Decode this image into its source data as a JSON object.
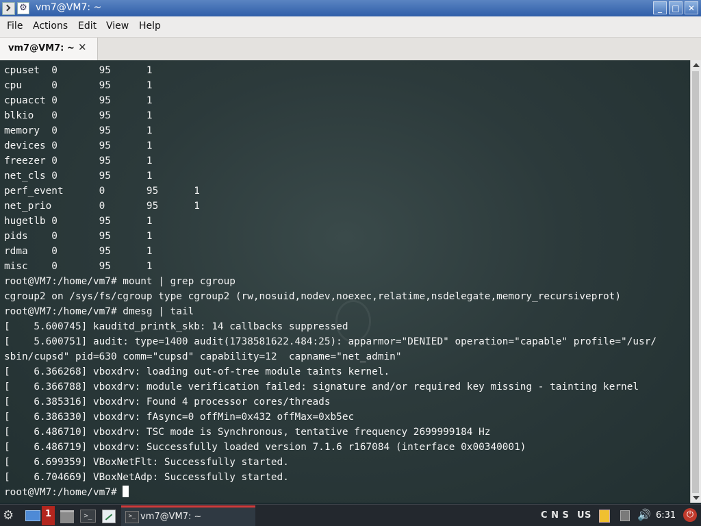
{
  "window": {
    "title": "vm7@VM7: ~",
    "minimize_glyph": "_",
    "maximize_glyph": "□",
    "close_glyph": "✕"
  },
  "menu": {
    "items": [
      "File",
      "Actions",
      "Edit",
      "View",
      "Help"
    ]
  },
  "tabs": [
    {
      "label": "vm7@VM7: ~",
      "close_glyph": "✕"
    }
  ],
  "terminal": {
    "lines": [
      "cpuset  0       95      1",
      "cpu     0       95      1",
      "cpuacct 0       95      1",
      "blkio   0       95      1",
      "memory  0       95      1",
      "devices 0       95      1",
      "freezer 0       95      1",
      "net_cls 0       95      1",
      "perf_event      0       95      1",
      "net_prio        0       95      1",
      "hugetlb 0       95      1",
      "pids    0       95      1",
      "rdma    0       95      1",
      "misc    0       95      1",
      "root@VM7:/home/vm7# mount | grep cgroup",
      "cgroup2 on /sys/fs/cgroup type cgroup2 (rw,nosuid,nodev,noexec,relatime,nsdelegate,memory_recursiveprot)",
      "root@VM7:/home/vm7# dmesg | tail",
      "[    5.600745] kauditd_printk_skb: 14 callbacks suppressed",
      "[    5.600751] audit: type=1400 audit(1738581622.484:25): apparmor=\"DENIED\" operation=\"capable\" profile=\"/usr/",
      "sbin/cupsd\" pid=630 comm=\"cupsd\" capability=12  capname=\"net_admin\"",
      "[    6.366268] vboxdrv: loading out-of-tree module taints kernel.",
      "[    6.366788] vboxdrv: module verification failed: signature and/or required key missing - tainting kernel",
      "[    6.385316] vboxdrv: Found 4 processor cores/threads",
      "[    6.386330] vboxdrv: fAsync=0 offMin=0x432 offMax=0xb5ec",
      "[    6.486710] vboxdrv: TSC mode is Synchronous, tentative frequency 2699999184 Hz",
      "[    6.486719] vboxdrv: Successfully loaded version 7.1.6 r167084 (interface 0x00340001)",
      "[    6.699359] VBoxNetFlt: Successfully started.",
      "[    6.704669] VBoxNetAdp: Successfully started."
    ],
    "prompt": "root@VM7:/home/vm7# "
  },
  "taskbar": {
    "workspace_number": "1",
    "active_task_label": "vm7@VM7: ~",
    "keyboard_indicators": "C N S",
    "layout": "US",
    "clock": "6:31",
    "icons": [
      "launcher-icon",
      "show-desktop-icon",
      "file-manager-icon",
      "terminal-icon",
      "text-editor-icon",
      "clipboard-icon",
      "network-icon",
      "volume-icon",
      "power-icon"
    ]
  }
}
